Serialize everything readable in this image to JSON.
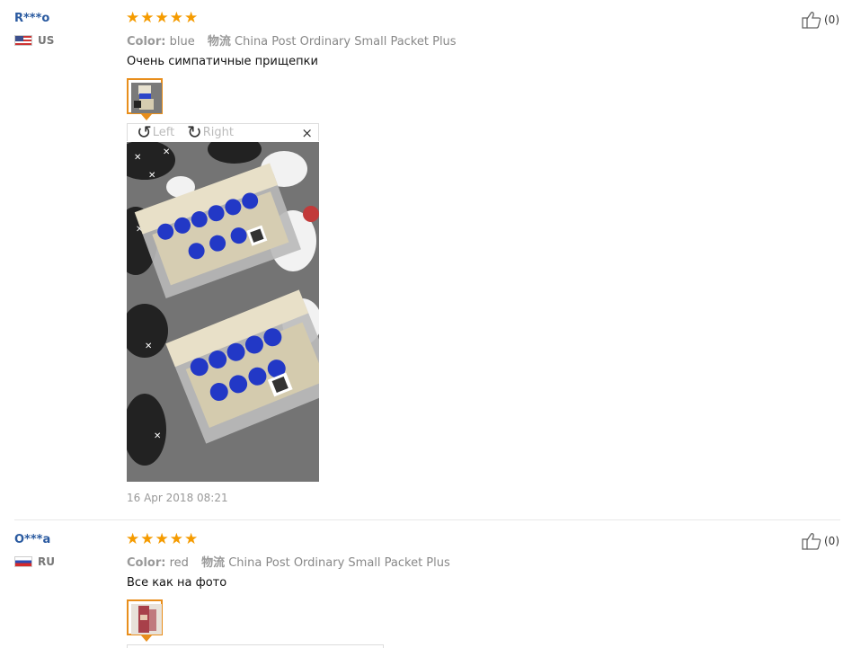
{
  "reviews": [
    {
      "user_name": "R***o",
      "country_code": "US",
      "rating": 5,
      "color_label": "Color:",
      "color_value": "blue",
      "shipping_label": "物流",
      "shipping_value": "China Post Ordinary Small Packet Plus",
      "text": "Очень симпатичные прищепки",
      "viewer": {
        "rotate_left": "Left",
        "rotate_right": "Right",
        "close": "×"
      },
      "date": "16 Apr 2018 08:21",
      "likes": "(0)"
    },
    {
      "user_name": "O***a",
      "country_code": "RU",
      "rating": 5,
      "color_label": "Color:",
      "color_value": "red",
      "shipping_label": "物流",
      "shipping_value": "China Post Ordinary Small Packet Plus",
      "text": "Все как на фото",
      "likes": "(0)"
    }
  ],
  "colors": {
    "star": "#f59b00",
    "accent": "#e88e1c",
    "user_link": "#2a5aa0"
  },
  "icons": {
    "star": "star-icon",
    "like": "thumbs-up-icon",
    "rotate_left": "rotate-left-icon",
    "rotate_right": "rotate-right-icon",
    "close": "close-icon"
  }
}
